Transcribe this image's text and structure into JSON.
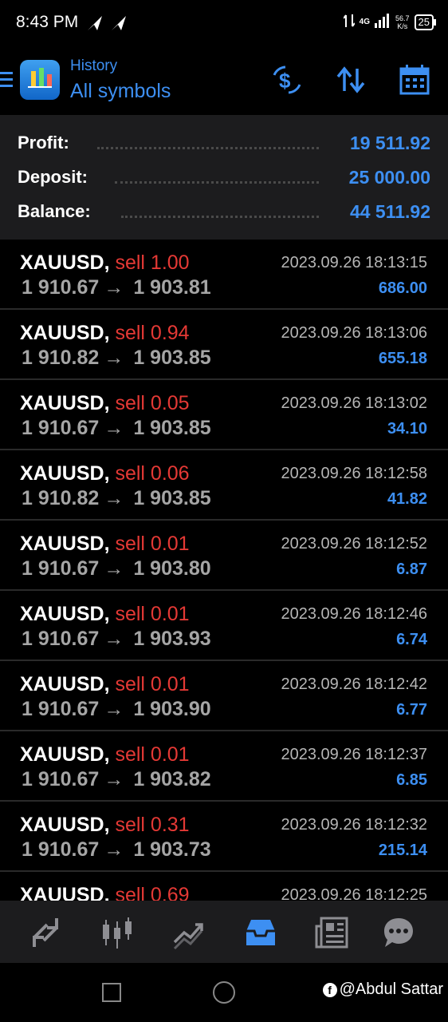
{
  "status": {
    "time": "8:43 PM",
    "network": "4G",
    "speed_value": "56.7",
    "speed_unit": "K/s",
    "battery": "25"
  },
  "header": {
    "subtitle": "History",
    "title": "All symbols",
    "accent_color": "#3d8ff2"
  },
  "summary": {
    "profit_label": "Profit:",
    "profit_value": "19 511.92",
    "deposit_label": "Deposit:",
    "deposit_value": "25 000.00",
    "balance_label": "Balance:",
    "balance_value": "44 511.92"
  },
  "trades": [
    {
      "symbol": "XAUUSD,",
      "side": "sell 1.00",
      "time": "2023.09.26 18:13:15",
      "open": "1 910.67",
      "close": "1 903.81",
      "profit": "686.00"
    },
    {
      "symbol": "XAUUSD,",
      "side": "sell 0.94",
      "time": "2023.09.26 18:13:06",
      "open": "1 910.82",
      "close": "1 903.85",
      "profit": "655.18"
    },
    {
      "symbol": "XAUUSD,",
      "side": "sell 0.05",
      "time": "2023.09.26 18:13:02",
      "open": "1 910.67",
      "close": "1 903.85",
      "profit": "34.10"
    },
    {
      "symbol": "XAUUSD,",
      "side": "sell 0.06",
      "time": "2023.09.26 18:12:58",
      "open": "1 910.82",
      "close": "1 903.85",
      "profit": "41.82"
    },
    {
      "symbol": "XAUUSD,",
      "side": "sell 0.01",
      "time": "2023.09.26 18:12:52",
      "open": "1 910.67",
      "close": "1 903.80",
      "profit": "6.87"
    },
    {
      "symbol": "XAUUSD,",
      "side": "sell 0.01",
      "time": "2023.09.26 18:12:46",
      "open": "1 910.67",
      "close": "1 903.93",
      "profit": "6.74"
    },
    {
      "symbol": "XAUUSD,",
      "side": "sell 0.01",
      "time": "2023.09.26 18:12:42",
      "open": "1 910.67",
      "close": "1 903.90",
      "profit": "6.77"
    },
    {
      "symbol": "XAUUSD,",
      "side": "sell 0.01",
      "time": "2023.09.26 18:12:37",
      "open": "1 910.67",
      "close": "1 903.82",
      "profit": "6.85"
    },
    {
      "symbol": "XAUUSD,",
      "side": "sell 0.31",
      "time": "2023.09.26 18:12:32",
      "open": "1 910.67",
      "close": "1 903.73",
      "profit": "215.14"
    },
    {
      "symbol": "XAUUSD,",
      "side": "sell 0.69",
      "time": "2023.09.26 18:12:25",
      "open": "",
      "close": "",
      "profit": ""
    }
  ],
  "trade_arrow": "→",
  "bottom_nav": [
    {
      "icon": "quotes-icon"
    },
    {
      "icon": "chart-icon"
    },
    {
      "icon": "trade-icon"
    },
    {
      "icon": "history-icon",
      "active": true
    },
    {
      "icon": "news-icon"
    },
    {
      "icon": "chat-icon"
    }
  ],
  "watermark": "@Abdul Sattar",
  "watermark_badge": "f"
}
